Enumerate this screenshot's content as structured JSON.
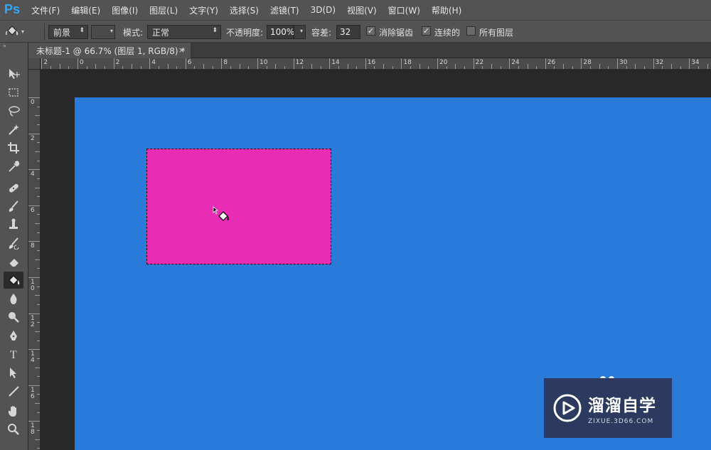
{
  "app": {
    "logo": "Ps"
  },
  "menu": [
    "文件(F)",
    "编辑(E)",
    "图像(I)",
    "图层(L)",
    "文字(Y)",
    "选择(S)",
    "滤镜(T)",
    "3D(D)",
    "视图(V)",
    "窗口(W)",
    "帮助(H)"
  ],
  "options": {
    "fill_source": "前景",
    "mode_label": "模式:",
    "mode_value": "正常",
    "opacity_label": "不透明度:",
    "opacity_value": "100%",
    "tolerance_label": "容差:",
    "tolerance_value": "32",
    "anti_alias_label": "消除锯齿",
    "anti_alias_checked": true,
    "contiguous_label": "连续的",
    "contiguous_checked": true,
    "all_layers_label": "所有图层",
    "all_layers_checked": false
  },
  "document": {
    "tab_title": "未标题-1 @ 66.7% (图层 1, RGB/8) *",
    "close_glyph": "×"
  },
  "tools": [
    "move-icon",
    "marquee-icon",
    "lasso-icon",
    "magic-wand-icon",
    "crop-icon",
    "eyedropper-icon",
    "healing-brush-icon",
    "brush-icon",
    "clone-stamp-icon",
    "history-brush-icon",
    "eraser-icon",
    "paint-bucket-icon",
    "blur-icon",
    "dodge-icon",
    "pen-icon",
    "type-icon",
    "path-selection-icon",
    "line-icon",
    "hand-icon",
    "zoom-icon"
  ],
  "active_tool": "paint-bucket-icon",
  "type_tool_glyph": "T",
  "ruler": {
    "h_labels": [
      "2",
      "0",
      "2",
      "4",
      "6",
      "8",
      "10",
      "12",
      "14",
      "16",
      "18",
      "20",
      "22",
      "24",
      "26",
      "28",
      "30",
      "32",
      "34"
    ],
    "v_labels": [
      "0",
      "2",
      "4",
      "6",
      "8",
      "10",
      "12",
      "14",
      "16",
      "18"
    ]
  },
  "colors": {
    "canvas": "#2a7ad9",
    "selection_fill": "#e82cb4",
    "ui_panel": "#535353",
    "workspace": "#282828"
  },
  "watermark": {
    "name": "溜溜自学",
    "url": "ZIXUE.3D66.COM"
  }
}
